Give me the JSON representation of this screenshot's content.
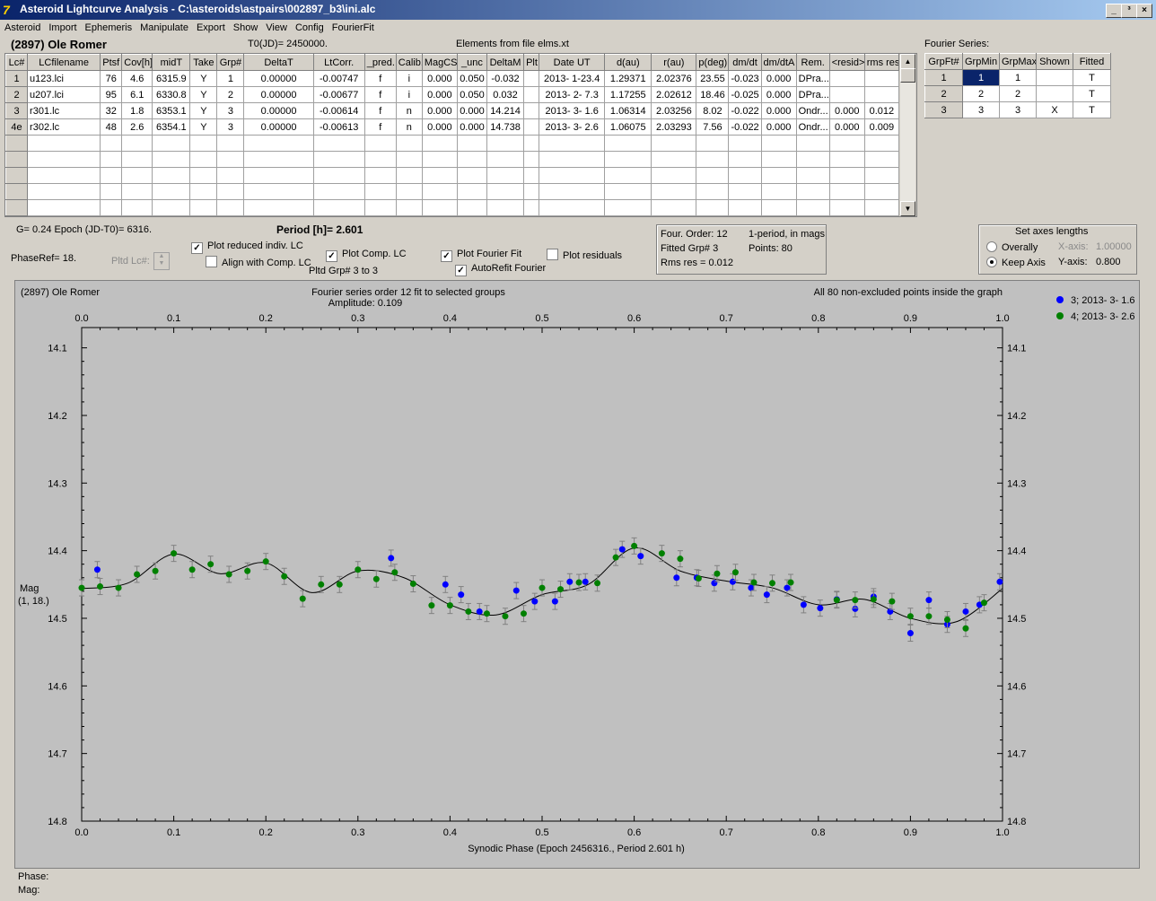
{
  "window": {
    "title": "Asteroid Lightcurve Analysis - C:\\asteroids\\astpairs\\002897_b3\\ini.alc",
    "app_icon": "7",
    "controls": [
      "_",
      "³",
      "×"
    ]
  },
  "menu": [
    "Asteroid",
    "Import",
    "Ephemeris",
    "Manipulate",
    "Export",
    "Show",
    "View",
    "Config",
    "FourierFit"
  ],
  "header": {
    "asteroid_name": "(2897) Ole Romer",
    "t0": "T0(JD)= 2450000.",
    "elements": "Elements from file elms.xt"
  },
  "lc_table": {
    "columns": [
      "Lc#",
      "LCfilename",
      "Ptsf",
      "Cov[h]",
      "midT",
      "Take",
      "Grp#",
      "DeltaT",
      "LtCorr.",
      "_pred.",
      "Calib.",
      "MagCS",
      "_unc",
      "DeltaM",
      "Plt",
      "Date UT",
      "d(au)",
      "r(au)",
      "p(deg)",
      "dm/dt",
      "dm/dtA",
      "Rem.",
      "<resid>",
      "rms res"
    ],
    "rows": [
      [
        "1",
        "u123.lci",
        "76",
        "4.6",
        "6315.9",
        "Y",
        "1",
        "0.00000",
        "-0.00747",
        "f",
        "i",
        "0.000",
        "0.050",
        "-0.032",
        "",
        "2013- 1-23.4",
        "1.29371",
        "2.02376",
        "23.55",
        "-0.023",
        "0.000",
        "DPra...",
        "",
        ""
      ],
      [
        "2",
        "u207.lci",
        "95",
        "6.1",
        "6330.8",
        "Y",
        "2",
        "0.00000",
        "-0.00677",
        "f",
        "i",
        "0.000",
        "0.050",
        "0.032",
        "",
        "2013- 2- 7.3",
        "1.17255",
        "2.02612",
        "18.46",
        "-0.025",
        "0.000",
        "DPra...",
        "",
        ""
      ],
      [
        "3",
        "r301.lc",
        "32",
        "1.8",
        "6353.1",
        "Y",
        "3",
        "0.00000",
        "-0.00614",
        "f",
        "n",
        "0.000",
        "0.000",
        "14.214",
        "",
        "2013- 3- 1.6",
        "1.06314",
        "2.03256",
        "8.02",
        "-0.022",
        "0.000",
        "Ondr...",
        "0.000",
        "0.012"
      ],
      [
        "4e",
        "r302.lc",
        "48",
        "2.6",
        "6354.1",
        "Y",
        "3",
        "0.00000",
        "-0.00613",
        "f",
        "n",
        "0.000",
        "0.000",
        "14.738",
        "",
        "2013- 3- 2.6",
        "1.06075",
        "2.03293",
        "7.56",
        "-0.022",
        "0.000",
        "Ondr...",
        "0.000",
        "0.009"
      ]
    ]
  },
  "fourier_table": {
    "title": "Fourier Series:",
    "columns": [
      "GrpFt#",
      "GrpMin",
      "GrpMax",
      "Shown",
      "Fitted"
    ],
    "rows": [
      [
        "1",
        "1",
        "1",
        "",
        "T"
      ],
      [
        "2",
        "2",
        "2",
        "",
        "T"
      ],
      [
        "3",
        "3",
        "3",
        "X",
        "T"
      ]
    ]
  },
  "controls": {
    "g_epoch": "G= 0.24   Epoch (JD-T0)= 6316.",
    "period": "Period [h]= 2.601",
    "phaseref": "PhaseRef= 18.",
    "pltd_lc": "Pltd Lc#:",
    "plot_reduced": "Plot reduced indiv. LC",
    "align_comp": "Align with Comp. LC",
    "plot_comp": "Plot Comp. LC",
    "pltd_grp": "Pltd Grp#  3  to  3",
    "plot_fourier": "Plot Fourier Fit",
    "autorefit": "AutoRefit Fourier",
    "plot_residuals": "Plot residuals",
    "checks": {
      "plot_reduced": true,
      "align_comp": false,
      "plot_comp": true,
      "plot_fourier": true,
      "autorefit": true,
      "plot_residuals": false
    },
    "info": {
      "four_order": "Four. Order: 12",
      "one_period": "1-period, in mags",
      "fitted_grp": "Fitted Grp# 3",
      "points": "Points: 80",
      "rms_res": "Rms res    = 0.012"
    },
    "axes_box": {
      "title": "Set axes lengths",
      "overally": "Overally",
      "keep_axis": "Keep Axis",
      "xaxis_label": "X-axis:",
      "xaxis_value": "1.00000",
      "yaxis_label": "Y-axis:",
      "yaxis_value": "0.800",
      "selected": "keep_axis"
    }
  },
  "plot": {
    "top_left": "(2897) Ole Romer",
    "center_title": "Fourier series order 12 fit to selected groups",
    "amplitude": "Amplitude: 0.109",
    "top_right": "All 80 non-excluded points inside the graph",
    "ylabel": "Mag",
    "ylabel_sub": "(1, 18.)",
    "xlabel": "Synodic Phase (Epoch 2456316., Period 2.601 h)"
  },
  "chart_data": {
    "type": "scatter",
    "x_ticks": [
      "0.0",
      "0.1",
      "0.2",
      "0.3",
      "0.4",
      "0.5",
      "0.6",
      "0.7",
      "0.8",
      "0.9",
      "1.0"
    ],
    "y_ticks": [
      "14.1",
      "14.2",
      "14.3",
      "14.4",
      "14.5",
      "14.6",
      "14.7",
      "14.8"
    ],
    "xlim": [
      0,
      1
    ],
    "ylim": [
      14.8,
      14.07
    ],
    "y_inverted": true,
    "series": [
      {
        "name": "3; 2013- 3- 1.6",
        "color": "#0000ff",
        "points": [
          [
            0.017,
            14.428
          ],
          [
            0.336,
            14.411
          ],
          [
            0.395,
            14.45
          ],
          [
            0.412,
            14.465
          ],
          [
            0.432,
            14.49
          ],
          [
            0.472,
            14.459
          ],
          [
            0.492,
            14.475
          ],
          [
            0.514,
            14.475
          ],
          [
            0.53,
            14.446
          ],
          [
            0.547,
            14.446
          ],
          [
            0.587,
            14.398
          ],
          [
            0.607,
            14.408
          ],
          [
            0.646,
            14.44
          ],
          [
            0.668,
            14.44
          ],
          [
            0.687,
            14.448
          ],
          [
            0.707,
            14.446
          ],
          [
            0.727,
            14.455
          ],
          [
            0.744,
            14.465
          ],
          [
            0.766,
            14.455
          ],
          [
            0.784,
            14.48
          ],
          [
            0.802,
            14.485
          ],
          [
            0.82,
            14.472
          ],
          [
            0.84,
            14.486
          ],
          [
            0.86,
            14.468
          ],
          [
            0.878,
            14.49
          ],
          [
            0.9,
            14.522
          ],
          [
            0.92,
            14.473
          ],
          [
            0.94,
            14.509
          ],
          [
            0.96,
            14.49
          ],
          [
            0.975,
            14.48
          ],
          [
            0.997,
            14.446
          ]
        ]
      },
      {
        "name": "4; 2013- 3- 2.6",
        "color": "#008000",
        "points": [
          [
            0.0,
            14.455
          ],
          [
            0.02,
            14.453
          ],
          [
            0.04,
            14.455
          ],
          [
            0.06,
            14.435
          ],
          [
            0.08,
            14.43
          ],
          [
            0.1,
            14.404
          ],
          [
            0.12,
            14.428
          ],
          [
            0.14,
            14.42
          ],
          [
            0.16,
            14.435
          ],
          [
            0.18,
            14.43
          ],
          [
            0.2,
            14.416
          ],
          [
            0.22,
            14.438
          ],
          [
            0.24,
            14.471
          ],
          [
            0.26,
            14.45
          ],
          [
            0.28,
            14.45
          ],
          [
            0.3,
            14.428
          ],
          [
            0.32,
            14.442
          ],
          [
            0.34,
            14.432
          ],
          [
            0.36,
            14.449
          ],
          [
            0.38,
            14.481
          ],
          [
            0.4,
            14.481
          ],
          [
            0.42,
            14.49
          ],
          [
            0.44,
            14.493
          ],
          [
            0.46,
            14.497
          ],
          [
            0.48,
            14.493
          ],
          [
            0.5,
            14.455
          ],
          [
            0.52,
            14.457
          ],
          [
            0.54,
            14.447
          ],
          [
            0.56,
            14.448
          ],
          [
            0.58,
            14.41
          ],
          [
            0.6,
            14.393
          ],
          [
            0.63,
            14.404
          ],
          [
            0.65,
            14.412
          ],
          [
            0.67,
            14.441
          ],
          [
            0.69,
            14.434
          ],
          [
            0.71,
            14.432
          ],
          [
            0.73,
            14.447
          ],
          [
            0.75,
            14.448
          ],
          [
            0.77,
            14.447
          ],
          [
            0.82,
            14.473
          ],
          [
            0.84,
            14.473
          ],
          [
            0.86,
            14.472
          ],
          [
            0.88,
            14.475
          ],
          [
            0.9,
            14.497
          ],
          [
            0.92,
            14.497
          ],
          [
            0.94,
            14.502
          ],
          [
            0.96,
            14.515
          ],
          [
            0.98,
            14.477
          ]
        ]
      }
    ],
    "fit": [
      [
        0.0,
        14.456
      ],
      [
        0.05,
        14.448
      ],
      [
        0.1,
        14.405
      ],
      [
        0.15,
        14.434
      ],
      [
        0.2,
        14.418
      ],
      [
        0.25,
        14.462
      ],
      [
        0.3,
        14.43
      ],
      [
        0.35,
        14.44
      ],
      [
        0.4,
        14.48
      ],
      [
        0.45,
        14.495
      ],
      [
        0.5,
        14.465
      ],
      [
        0.55,
        14.45
      ],
      [
        0.6,
        14.396
      ],
      [
        0.65,
        14.43
      ],
      [
        0.7,
        14.445
      ],
      [
        0.75,
        14.455
      ],
      [
        0.8,
        14.48
      ],
      [
        0.85,
        14.472
      ],
      [
        0.9,
        14.5
      ],
      [
        0.95,
        14.505
      ],
      [
        1.0,
        14.456
      ]
    ]
  }
}
